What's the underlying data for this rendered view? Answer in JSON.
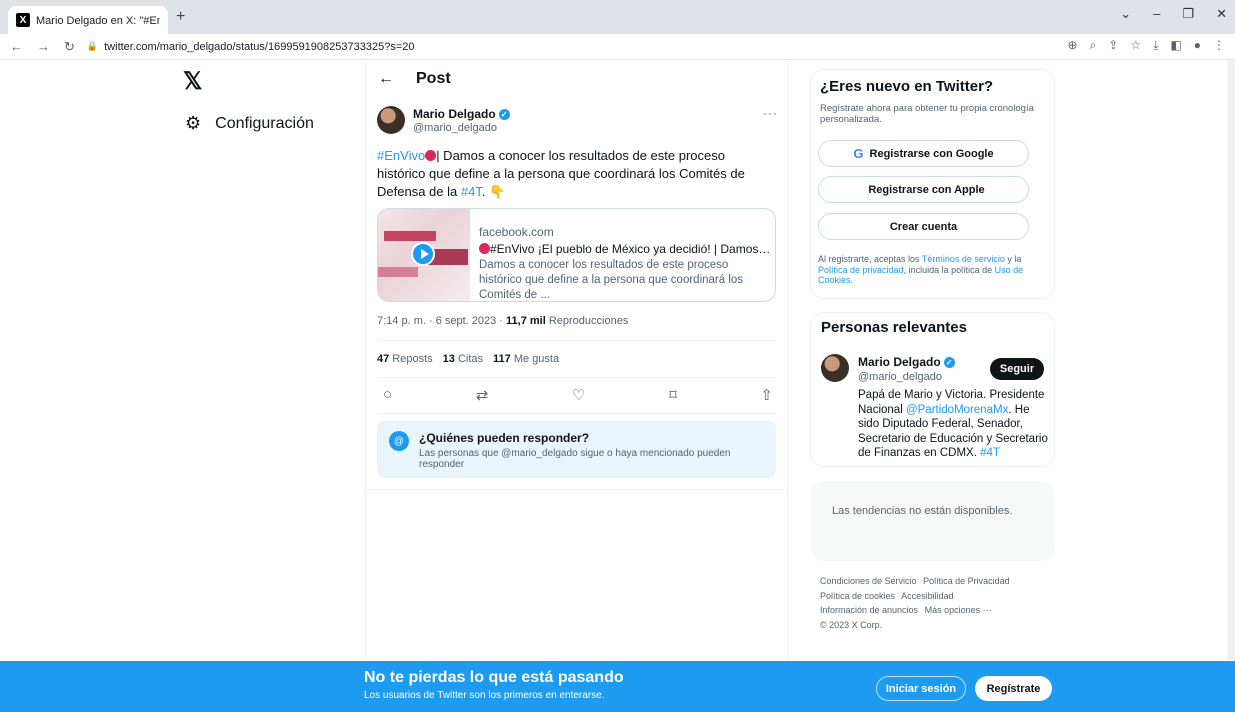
{
  "browser": {
    "tab_title": "Mario Delgado en X: \"#EnVivo🔴 ×",
    "tab_favicon": "X",
    "new_tab": "+",
    "url": "twitter.com/mario_delgado/status/1699591908253733325?s=20",
    "nav_icons": [
      "back-arrow-icon",
      "forward-arrow-icon",
      "reload-icon"
    ],
    "window_controls": [
      "⌄",
      "–",
      "❐",
      "✕"
    ]
  },
  "left_nav": {
    "logo": "𝕏",
    "settings_label": "Configuración"
  },
  "post": {
    "header_title": "Post",
    "author_name": "Mario Delgado",
    "author_handle": "@mario_delgado",
    "more": "···",
    "text_hashtag1": "#EnVivo",
    "text_body": "| Damos a conocer los resultados de este proceso histórico que define a la persona que coordinará los Comités de Defensa de la ",
    "text_hashtag2": "#4T",
    "text_end": ". 👇",
    "card": {
      "domain": "facebook.com",
      "title": "#EnVivo ¡El pueblo de México ya decidió! | Damos a con...",
      "description": "Damos a conocer los resultados de este proceso histórico que define a la persona que coordinará los Comités de ..."
    },
    "timestamp": "7:14 p. m. · 6 sept. 2023 · ",
    "views_count": "11,7 mil",
    "views_label": " Reproducciones",
    "reposts_count": "47",
    "reposts_label": " Reposts",
    "quotes_count": "13",
    "quotes_label": " Citas",
    "likes_count": "117",
    "likes_label": " Me gusta",
    "reply_box": {
      "title": "¿Quiénes pueden responder?",
      "text": "Las personas que @mario_delgado sigue o haya mencionado pueden responder"
    }
  },
  "signup": {
    "title": "¿Eres nuevo en Twitter?",
    "description": "Regístrate ahora para obtener tu propia cronología personalizada.",
    "google_label": "Registrarse con Google",
    "apple_label": "Registrarse con Apple",
    "create_label": "Crear cuenta",
    "terms_prefix": "Al registrarte, aceptas los ",
    "terms_link": "Términos de servicio",
    "terms_mid": " y la ",
    "privacy_link": "Política de privacidad",
    "terms_mid2": ", incluida la política de ",
    "cookies_link": "Uso de Cookies",
    "terms_end": "."
  },
  "relevant": {
    "title": "Personas relevantes",
    "name": "Mario Delgado",
    "handle": "@mario_delgado",
    "follow_label": "Seguir",
    "bio_1": "Papá de Mario y Victoria. Presidente Nacional ",
    "bio_link": "@PartidoMorenaMx",
    "bio_2": ". He sido Diputado Federal, Senador, Secretario de Educación y Secretario de Finanzas en CDMX. ",
    "bio_tag": "#4T"
  },
  "trends": {
    "text": "Las tendencias no están disponibles."
  },
  "footer": {
    "links": [
      "Condiciones de Servicio",
      "Política de Privacidad",
      "Política de cookies",
      "Accesibilidad",
      "Información de anuncios",
      "Más opciones ···"
    ],
    "copyright": "© 2023 X Corp."
  },
  "banner": {
    "title": "No te pierdas lo que está pasando",
    "subtitle": "Los usuarios de Twitter son los primeros en enterarse.",
    "login_label": "Iniciar sesión",
    "register_label": "Regístrate"
  },
  "colors": {
    "brand_blue": "#1d9bf0",
    "text_primary": "#0f1419",
    "text_secondary": "#536471"
  }
}
